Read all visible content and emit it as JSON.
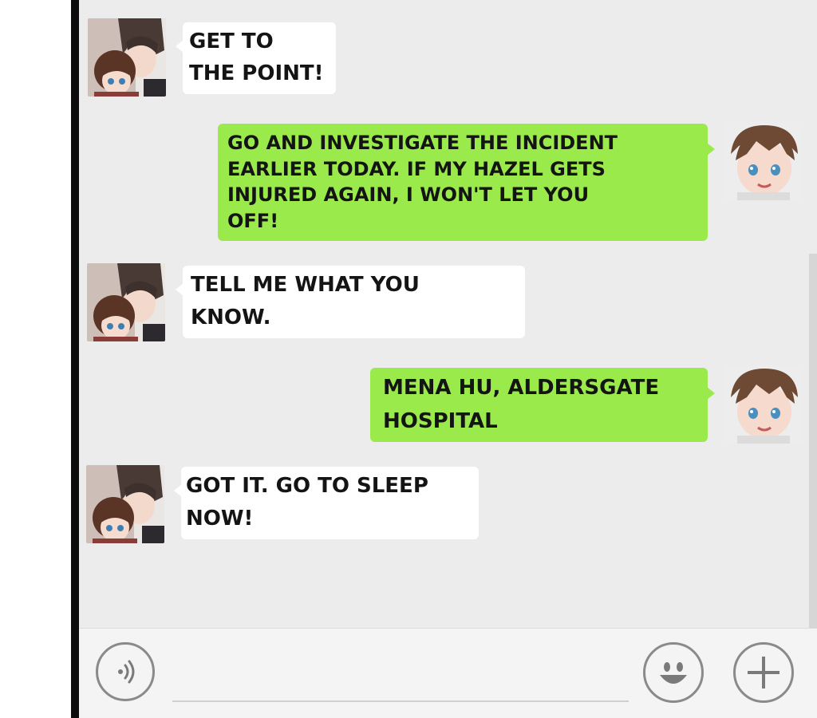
{
  "chat": {
    "messages": [
      {
        "from": "contact",
        "text": "GET TO\nTHE POINT!"
      },
      {
        "from": "self",
        "text": "GO AND INVESTIGATE THE INCIDENT\nEARLIER TODAY. IF MY HAZEL GETS\nINJURED AGAIN, I WON'T LET YOU\nOFF!"
      },
      {
        "from": "contact",
        "text": "TELL ME WHAT YOU\nKNOW."
      },
      {
        "from": "self",
        "text": "MENA HU, ALDERSGATE\nHOSPITAL"
      },
      {
        "from": "contact",
        "text": " GOT IT. GO TO SLEEP\nNOW!"
      }
    ]
  },
  "input_bar": {
    "voice_icon": "voice-wave-icon",
    "emoji_icon": "smiley-face-icon",
    "add_icon": "plus-icon"
  },
  "colors": {
    "chat_background": "#ececec",
    "incoming_bubble": "#ffffff",
    "outgoing_bubble": "#9bea4b",
    "input_bar": "#f4f4f4",
    "border": "#0c0c0c"
  }
}
